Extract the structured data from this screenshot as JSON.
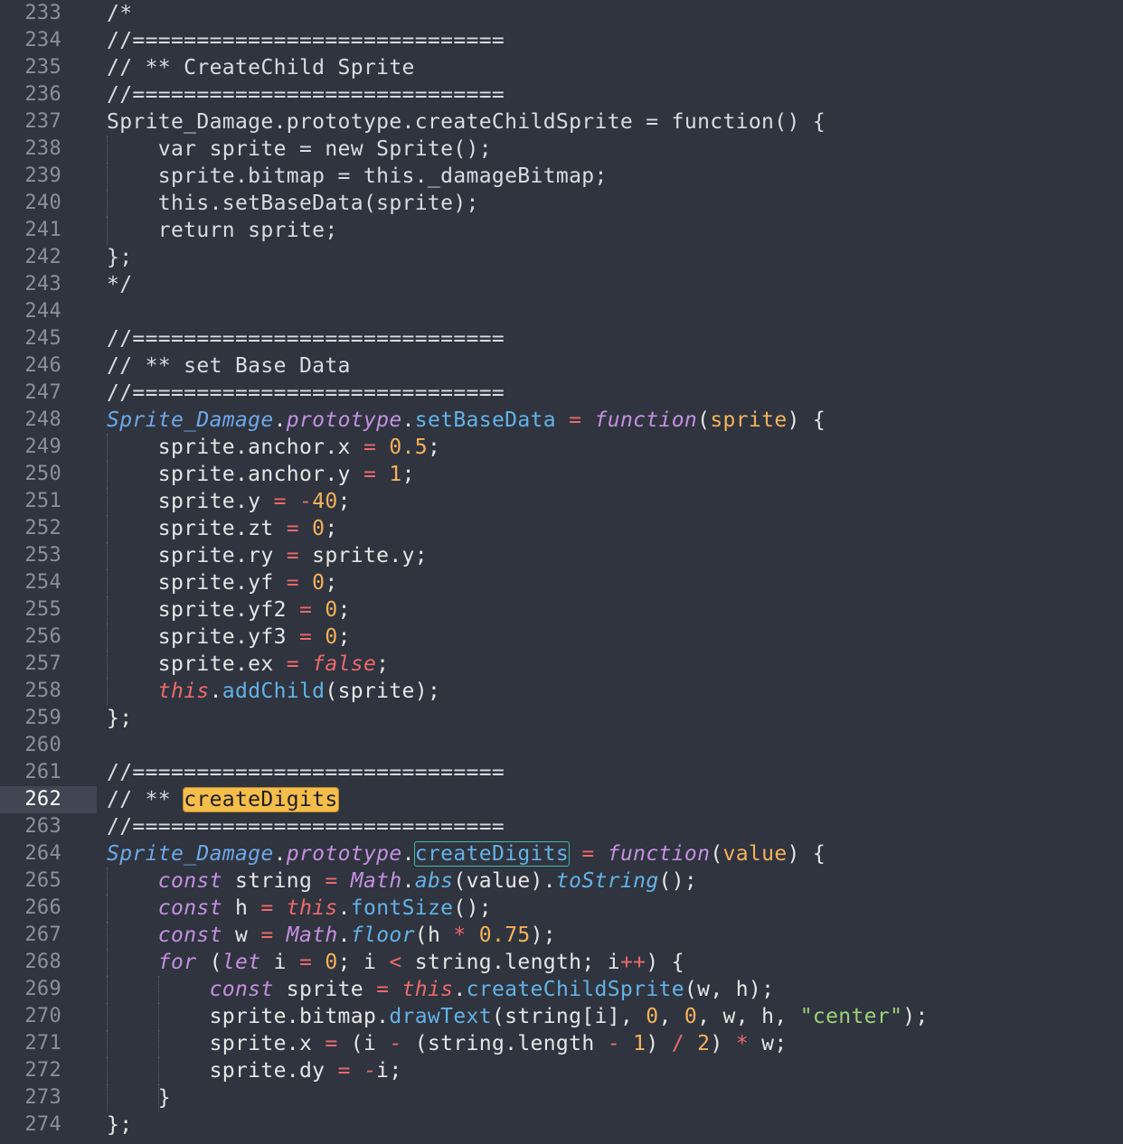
{
  "editor": {
    "current_line": 262,
    "theme_colors": {
      "background": "#2f343f",
      "gutter_text": "#8b919b",
      "highlight": "#f5be4a",
      "selection_outline": "#45bda6"
    },
    "lines": [
      {
        "n": "233",
        "indent": 0,
        "tokens": [
          {
            "t": "/*",
            "c": "c"
          }
        ]
      },
      {
        "n": "234",
        "indent": 0,
        "tokens": [
          {
            "t": "//=============================",
            "c": "c"
          }
        ]
      },
      {
        "n": "235",
        "indent": 0,
        "tokens": [
          {
            "t": "// ** CreateChild Sprite",
            "c": "c"
          }
        ]
      },
      {
        "n": "236",
        "indent": 0,
        "tokens": [
          {
            "t": "//=============================",
            "c": "c"
          }
        ]
      },
      {
        "n": "237",
        "indent": 0,
        "tokens": [
          {
            "t": "Sprite_Damage.prototype.createChildSprite = function() {",
            "c": "c"
          }
        ]
      },
      {
        "n": "238",
        "indent": 1,
        "tokens": [
          {
            "t": "    var sprite = new Sprite();",
            "c": "c"
          }
        ]
      },
      {
        "n": "239",
        "indent": 1,
        "tokens": [
          {
            "t": "    sprite.bitmap = this._damageBitmap;",
            "c": "c"
          }
        ]
      },
      {
        "n": "240",
        "indent": 1,
        "tokens": [
          {
            "t": "    this.setBaseData(sprite);",
            "c": "c"
          }
        ]
      },
      {
        "n": "241",
        "indent": 1,
        "tokens": [
          {
            "t": "    return sprite;",
            "c": "c"
          }
        ]
      },
      {
        "n": "242",
        "indent": 0,
        "tokens": [
          {
            "t": "};",
            "c": "c"
          }
        ]
      },
      {
        "n": "243",
        "indent": 0,
        "tokens": [
          {
            "t": "*/",
            "c": "c"
          }
        ]
      },
      {
        "n": "244",
        "indent": 0,
        "tokens": []
      },
      {
        "n": "245",
        "indent": 0,
        "tokens": [
          {
            "t": "//=============================",
            "c": "c"
          }
        ]
      },
      {
        "n": "246",
        "indent": 0,
        "tokens": [
          {
            "t": "// ** set Base Data",
            "c": "c"
          }
        ]
      },
      {
        "n": "247",
        "indent": 0,
        "tokens": [
          {
            "t": "//=============================",
            "c": "c"
          }
        ]
      },
      {
        "n": "248",
        "indent": 0,
        "tokens": [
          {
            "t": "Sprite_Damage",
            "c": "cls"
          },
          {
            "t": ".",
            "c": "punc"
          },
          {
            "t": "prototype",
            "c": "proto"
          },
          {
            "t": ".",
            "c": "punc"
          },
          {
            "t": "setBaseData",
            "c": "fn"
          },
          {
            "t": " ",
            "c": "punc"
          },
          {
            "t": "=",
            "c": "op"
          },
          {
            "t": " ",
            "c": "punc"
          },
          {
            "t": "function",
            "c": "kw"
          },
          {
            "t": "(",
            "c": "punc"
          },
          {
            "t": "sprite",
            "c": "param"
          },
          {
            "t": ") {",
            "c": "punc"
          }
        ]
      },
      {
        "n": "249",
        "indent": 1,
        "tokens": [
          {
            "t": "    sprite.anchor.x ",
            "c": "punc"
          },
          {
            "t": "=",
            "c": "op"
          },
          {
            "t": " ",
            "c": "punc"
          },
          {
            "t": "0.5",
            "c": "num"
          },
          {
            "t": ";",
            "c": "punc"
          }
        ]
      },
      {
        "n": "250",
        "indent": 1,
        "tokens": [
          {
            "t": "    sprite.anchor.y ",
            "c": "punc"
          },
          {
            "t": "=",
            "c": "op"
          },
          {
            "t": " ",
            "c": "punc"
          },
          {
            "t": "1",
            "c": "num"
          },
          {
            "t": ";",
            "c": "punc"
          }
        ]
      },
      {
        "n": "251",
        "indent": 1,
        "tokens": [
          {
            "t": "    sprite.y ",
            "c": "punc"
          },
          {
            "t": "=",
            "c": "op"
          },
          {
            "t": " ",
            "c": "punc"
          },
          {
            "t": "-",
            "c": "op"
          },
          {
            "t": "40",
            "c": "num"
          },
          {
            "t": ";",
            "c": "punc"
          }
        ]
      },
      {
        "n": "252",
        "indent": 1,
        "tokens": [
          {
            "t": "    sprite.zt ",
            "c": "punc"
          },
          {
            "t": "=",
            "c": "op"
          },
          {
            "t": " ",
            "c": "punc"
          },
          {
            "t": "0",
            "c": "num"
          },
          {
            "t": ";",
            "c": "punc"
          }
        ]
      },
      {
        "n": "253",
        "indent": 1,
        "tokens": [
          {
            "t": "    sprite.ry ",
            "c": "punc"
          },
          {
            "t": "=",
            "c": "op"
          },
          {
            "t": " sprite.y;",
            "c": "punc"
          }
        ]
      },
      {
        "n": "254",
        "indent": 1,
        "tokens": [
          {
            "t": "    sprite.yf ",
            "c": "punc"
          },
          {
            "t": "=",
            "c": "op"
          },
          {
            "t": " ",
            "c": "punc"
          },
          {
            "t": "0",
            "c": "num"
          },
          {
            "t": ";",
            "c": "punc"
          }
        ]
      },
      {
        "n": "255",
        "indent": 1,
        "tokens": [
          {
            "t": "    sprite.yf2 ",
            "c": "punc"
          },
          {
            "t": "=",
            "c": "op"
          },
          {
            "t": " ",
            "c": "punc"
          },
          {
            "t": "0",
            "c": "num"
          },
          {
            "t": ";",
            "c": "punc"
          }
        ]
      },
      {
        "n": "256",
        "indent": 1,
        "tokens": [
          {
            "t": "    sprite.yf3 ",
            "c": "punc"
          },
          {
            "t": "=",
            "c": "op"
          },
          {
            "t": " ",
            "c": "punc"
          },
          {
            "t": "0",
            "c": "num"
          },
          {
            "t": ";",
            "c": "punc"
          }
        ]
      },
      {
        "n": "257",
        "indent": 1,
        "tokens": [
          {
            "t": "    sprite.ex ",
            "c": "punc"
          },
          {
            "t": "=",
            "c": "op"
          },
          {
            "t": " ",
            "c": "punc"
          },
          {
            "t": "false",
            "c": "bool"
          },
          {
            "t": ";",
            "c": "punc"
          }
        ]
      },
      {
        "n": "258",
        "indent": 1,
        "tokens": [
          {
            "t": "    ",
            "c": "punc"
          },
          {
            "t": "this",
            "c": "this"
          },
          {
            "t": ".",
            "c": "punc"
          },
          {
            "t": "addChild",
            "c": "fn"
          },
          {
            "t": "(sprite);",
            "c": "punc"
          }
        ]
      },
      {
        "n": "259",
        "indent": 0,
        "tokens": [
          {
            "t": "};",
            "c": "punc"
          }
        ]
      },
      {
        "n": "260",
        "indent": 0,
        "tokens": []
      },
      {
        "n": "261",
        "indent": 0,
        "tokens": [
          {
            "t": "//=============================",
            "c": "c"
          }
        ]
      },
      {
        "n": "262",
        "indent": 0,
        "tokens": [
          {
            "t": "// ** ",
            "c": "c"
          },
          {
            "t": "createDigits",
            "c": "hl"
          }
        ]
      },
      {
        "n": "263",
        "indent": 0,
        "tokens": [
          {
            "t": "//=============================",
            "c": "c"
          }
        ]
      },
      {
        "n": "264",
        "indent": 0,
        "tokens": [
          {
            "t": "Sprite_Damage",
            "c": "cls"
          },
          {
            "t": ".",
            "c": "punc"
          },
          {
            "t": "prototype",
            "c": "proto"
          },
          {
            "t": ".",
            "c": "punc"
          },
          {
            "t": "createDigits",
            "c": "sel"
          },
          {
            "t": " ",
            "c": "punc"
          },
          {
            "t": "=",
            "c": "op"
          },
          {
            "t": " ",
            "c": "punc"
          },
          {
            "t": "function",
            "c": "kw"
          },
          {
            "t": "(",
            "c": "punc"
          },
          {
            "t": "value",
            "c": "param"
          },
          {
            "t": ") {",
            "c": "punc"
          }
        ]
      },
      {
        "n": "265",
        "indent": 1,
        "tokens": [
          {
            "t": "    ",
            "c": "punc"
          },
          {
            "t": "const",
            "c": "kw"
          },
          {
            "t": " string ",
            "c": "punc"
          },
          {
            "t": "=",
            "c": "op"
          },
          {
            "t": " ",
            "c": "punc"
          },
          {
            "t": "Math",
            "c": "math"
          },
          {
            "t": ".",
            "c": "punc"
          },
          {
            "t": "abs",
            "c": "fni"
          },
          {
            "t": "(value).",
            "c": "punc"
          },
          {
            "t": "toString",
            "c": "fni"
          },
          {
            "t": "();",
            "c": "punc"
          }
        ]
      },
      {
        "n": "266",
        "indent": 1,
        "tokens": [
          {
            "t": "    ",
            "c": "punc"
          },
          {
            "t": "const",
            "c": "kw"
          },
          {
            "t": " h ",
            "c": "punc"
          },
          {
            "t": "=",
            "c": "op"
          },
          {
            "t": " ",
            "c": "punc"
          },
          {
            "t": "this",
            "c": "this"
          },
          {
            "t": ".",
            "c": "punc"
          },
          {
            "t": "fontSize",
            "c": "fn"
          },
          {
            "t": "();",
            "c": "punc"
          }
        ]
      },
      {
        "n": "267",
        "indent": 1,
        "tokens": [
          {
            "t": "    ",
            "c": "punc"
          },
          {
            "t": "const",
            "c": "kw"
          },
          {
            "t": " w ",
            "c": "punc"
          },
          {
            "t": "=",
            "c": "op"
          },
          {
            "t": " ",
            "c": "punc"
          },
          {
            "t": "Math",
            "c": "math"
          },
          {
            "t": ".",
            "c": "punc"
          },
          {
            "t": "floor",
            "c": "fni"
          },
          {
            "t": "(h ",
            "c": "punc"
          },
          {
            "t": "*",
            "c": "op"
          },
          {
            "t": " ",
            "c": "punc"
          },
          {
            "t": "0.75",
            "c": "num"
          },
          {
            "t": ");",
            "c": "punc"
          }
        ]
      },
      {
        "n": "268",
        "indent": 1,
        "tokens": [
          {
            "t": "    ",
            "c": "punc"
          },
          {
            "t": "for",
            "c": "kw"
          },
          {
            "t": " (",
            "c": "punc"
          },
          {
            "t": "let",
            "c": "kw"
          },
          {
            "t": " i ",
            "c": "punc"
          },
          {
            "t": "=",
            "c": "op"
          },
          {
            "t": " ",
            "c": "punc"
          },
          {
            "t": "0",
            "c": "num"
          },
          {
            "t": "; i ",
            "c": "punc"
          },
          {
            "t": "<",
            "c": "op"
          },
          {
            "t": " string.length; i",
            "c": "punc"
          },
          {
            "t": "++",
            "c": "op"
          },
          {
            "t": ") {",
            "c": "punc"
          }
        ]
      },
      {
        "n": "269",
        "indent": 2,
        "tokens": [
          {
            "t": "        ",
            "c": "punc"
          },
          {
            "t": "const",
            "c": "kw"
          },
          {
            "t": " sprite ",
            "c": "punc"
          },
          {
            "t": "=",
            "c": "op"
          },
          {
            "t": " ",
            "c": "punc"
          },
          {
            "t": "this",
            "c": "this"
          },
          {
            "t": ".",
            "c": "punc"
          },
          {
            "t": "createChildSprite",
            "c": "fn"
          },
          {
            "t": "(w, h);",
            "c": "punc"
          }
        ]
      },
      {
        "n": "270",
        "indent": 2,
        "tokens": [
          {
            "t": "        sprite.bitmap.",
            "c": "punc"
          },
          {
            "t": "drawText",
            "c": "fn"
          },
          {
            "t": "(string[i], ",
            "c": "punc"
          },
          {
            "t": "0",
            "c": "num"
          },
          {
            "t": ", ",
            "c": "punc"
          },
          {
            "t": "0",
            "c": "num"
          },
          {
            "t": ", w, h, ",
            "c": "punc"
          },
          {
            "t": "\"center\"",
            "c": "str"
          },
          {
            "t": ");",
            "c": "punc"
          }
        ]
      },
      {
        "n": "271",
        "indent": 2,
        "tokens": [
          {
            "t": "        sprite.x ",
            "c": "punc"
          },
          {
            "t": "=",
            "c": "op"
          },
          {
            "t": " (i ",
            "c": "punc"
          },
          {
            "t": "-",
            "c": "op"
          },
          {
            "t": " (string.length ",
            "c": "punc"
          },
          {
            "t": "-",
            "c": "op"
          },
          {
            "t": " ",
            "c": "punc"
          },
          {
            "t": "1",
            "c": "num"
          },
          {
            "t": ") ",
            "c": "punc"
          },
          {
            "t": "/",
            "c": "op"
          },
          {
            "t": " ",
            "c": "punc"
          },
          {
            "t": "2",
            "c": "num"
          },
          {
            "t": ") ",
            "c": "punc"
          },
          {
            "t": "*",
            "c": "op"
          },
          {
            "t": " w;",
            "c": "punc"
          }
        ]
      },
      {
        "n": "272",
        "indent": 2,
        "tokens": [
          {
            "t": "        sprite.dy ",
            "c": "punc"
          },
          {
            "t": "=",
            "c": "op"
          },
          {
            "t": " ",
            "c": "punc"
          },
          {
            "t": "-",
            "c": "op"
          },
          {
            "t": "i;",
            "c": "punc"
          }
        ]
      },
      {
        "n": "273",
        "indent": 2,
        "tokens": [
          {
            "t": "    }",
            "c": "punc"
          }
        ]
      },
      {
        "n": "274",
        "indent": 0,
        "tokens": [
          {
            "t": "};",
            "c": "punc"
          }
        ]
      }
    ]
  }
}
